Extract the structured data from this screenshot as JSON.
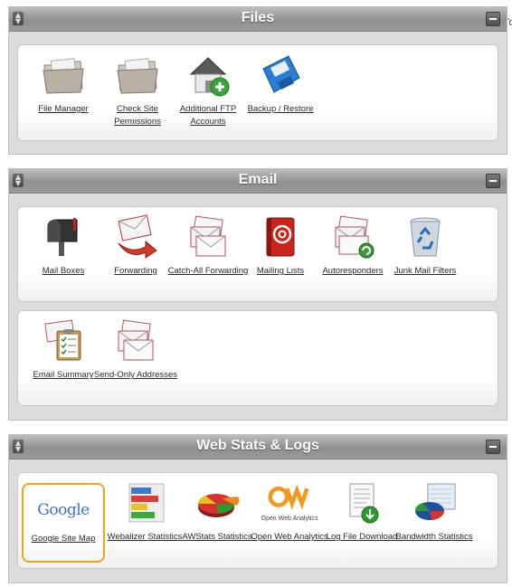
{
  "side_text": "To",
  "sections": {
    "files": {
      "title": "Files",
      "items": [
        {
          "label": "File Manager",
          "icon": "folder-icon"
        },
        {
          "label": "Check Site Permissions",
          "icon": "folder-icon"
        },
        {
          "label": "Additional FTP Accounts",
          "icon": "house-add-icon"
        },
        {
          "label": "Backup / Restore",
          "icon": "floppy-disk-icon"
        }
      ]
    },
    "email": {
      "title": "Email",
      "items": [
        {
          "label": "Mail Boxes",
          "icon": "mailbox-icon"
        },
        {
          "label": "Forwarding",
          "icon": "envelope-forward-icon"
        },
        {
          "label": "Catch-All Forwarding",
          "icon": "envelopes-icon"
        },
        {
          "label": "Mailing Lists",
          "icon": "address-book-icon"
        },
        {
          "label": "Autoresponders",
          "icon": "envelope-autoreply-icon"
        },
        {
          "label": "Junk Mail Filters",
          "icon": "recycle-bin-icon"
        },
        {
          "label": "Email Summary",
          "icon": "email-clipboard-icon"
        },
        {
          "label": "Send-Only Addresses",
          "icon": "envelopes-icon"
        }
      ]
    },
    "webstats": {
      "title": "Web Stats & Logs",
      "items": [
        {
          "label": "Google Site Map",
          "icon": "google-logo-icon",
          "logo_text": "Google"
        },
        {
          "label": "Webalizer Statistics",
          "icon": "bar-chart-icon"
        },
        {
          "label": "AWStats Statistics",
          "icon": "pie-chart-icon"
        },
        {
          "label": "Open Web Analytics",
          "icon": "owa-logo-icon",
          "logo_text": "Open Web Analytics"
        },
        {
          "label": "Log File Download",
          "icon": "log-file-download-icon"
        },
        {
          "label": "Bandwidth Statistics",
          "icon": "bandwidth-chart-icon"
        }
      ]
    }
  }
}
